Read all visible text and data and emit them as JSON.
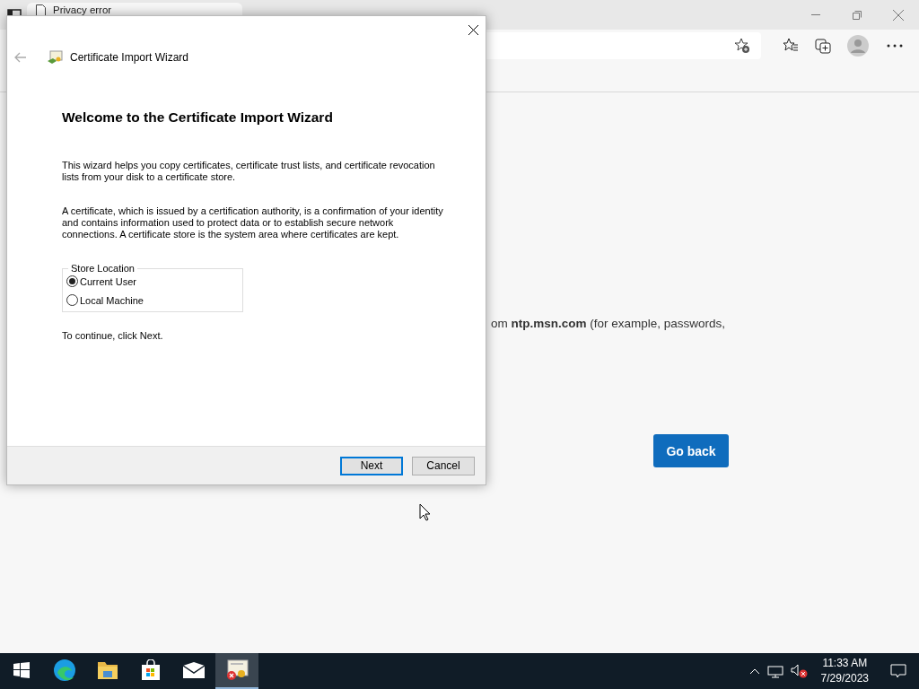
{
  "browser": {
    "tab": {
      "title": "Privacy error"
    },
    "page": {
      "body_text": "om **ntp.msn.com** (for example, passwords,",
      "go_back_button": "Go back"
    }
  },
  "dialog": {
    "title": "Certificate Import Wizard",
    "heading": "Welcome to the Certificate Import Wizard",
    "paragraphs": [
      "This wizard helps you copy certificates, certificate trust lists, and certificate revocation lists from your disk to a certificate store.",
      "A certificate, which is issued by a certification authority, is a confirmation of your identity and contains information used to protect data or to establish secure network connections. A certificate store is the system area where certificates are kept."
    ],
    "store_location": {
      "label": "Store Location",
      "options": [
        {
          "label": "Current User",
          "selected": true
        },
        {
          "label": "Local Machine",
          "selected": false
        }
      ]
    },
    "instruction": "To continue, click Next.",
    "buttons": [
      {
        "label": "Next",
        "default": true
      },
      {
        "label": "Cancel",
        "default": false
      }
    ]
  },
  "taskbar": {
    "apps": [
      {
        "kind": "edge",
        "active": false
      },
      {
        "kind": "folder",
        "active": false
      },
      {
        "kind": "store",
        "active": false
      },
      {
        "kind": "mail",
        "active": false
      },
      {
        "kind": "certificate",
        "active": true
      }
    ],
    "time": "11:33 AM",
    "date": "7/29/2023"
  }
}
